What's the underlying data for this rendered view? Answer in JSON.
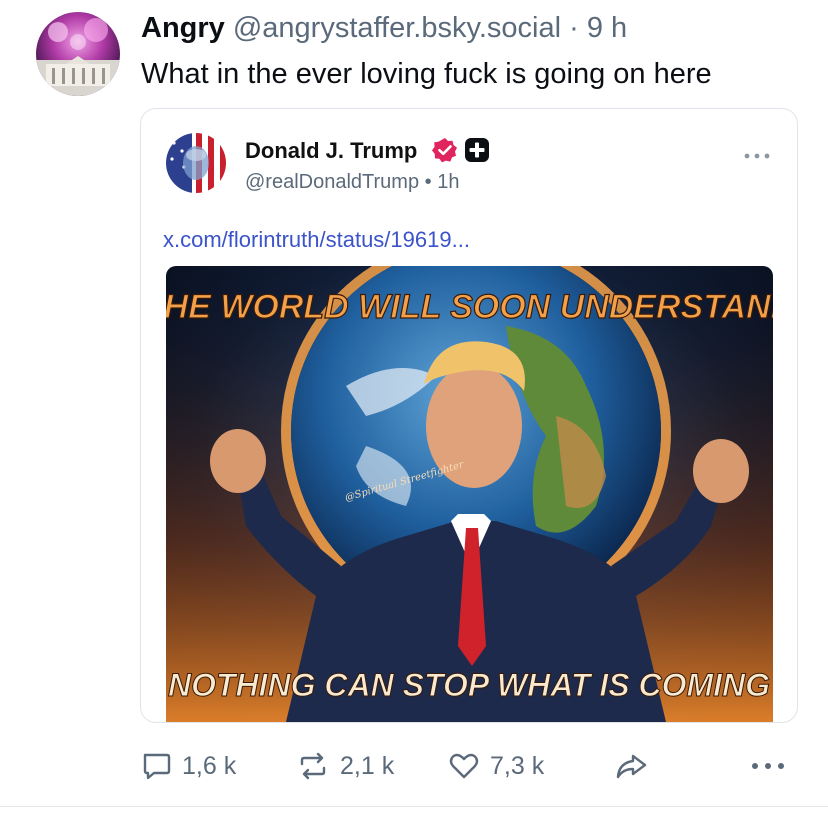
{
  "post": {
    "author_name": "Angry",
    "author_handle": "@angrystaffer.bsky.social",
    "separator": "·",
    "time": "9 h",
    "text": "What in the ever loving fuck is going on here"
  },
  "quote": {
    "name": "Donald J. Trump",
    "handle": "@realDonaldTrump",
    "separator": "•",
    "time": "1h",
    "link_text": "x.com/florintruth/status/19619...",
    "image_caption_top": "THE WORLD WILL SOON UNDERSTAND",
    "image_caption_bottom": "NOTHING CAN STOP WHAT IS COMING",
    "image_watermark": "@Spiritual Streetfighter"
  },
  "actions": {
    "replies": "1,6 k",
    "reposts": "2,1 k",
    "likes": "7,3 k"
  },
  "colors": {
    "muted": "#5b6a7a",
    "link": "#3c53c9",
    "verified": "#e0245e"
  },
  "icons": [
    "verified-icon",
    "plus-badge-icon",
    "more-options-icon",
    "reply-icon",
    "repost-icon",
    "like-icon",
    "share-icon",
    "more-icon"
  ]
}
